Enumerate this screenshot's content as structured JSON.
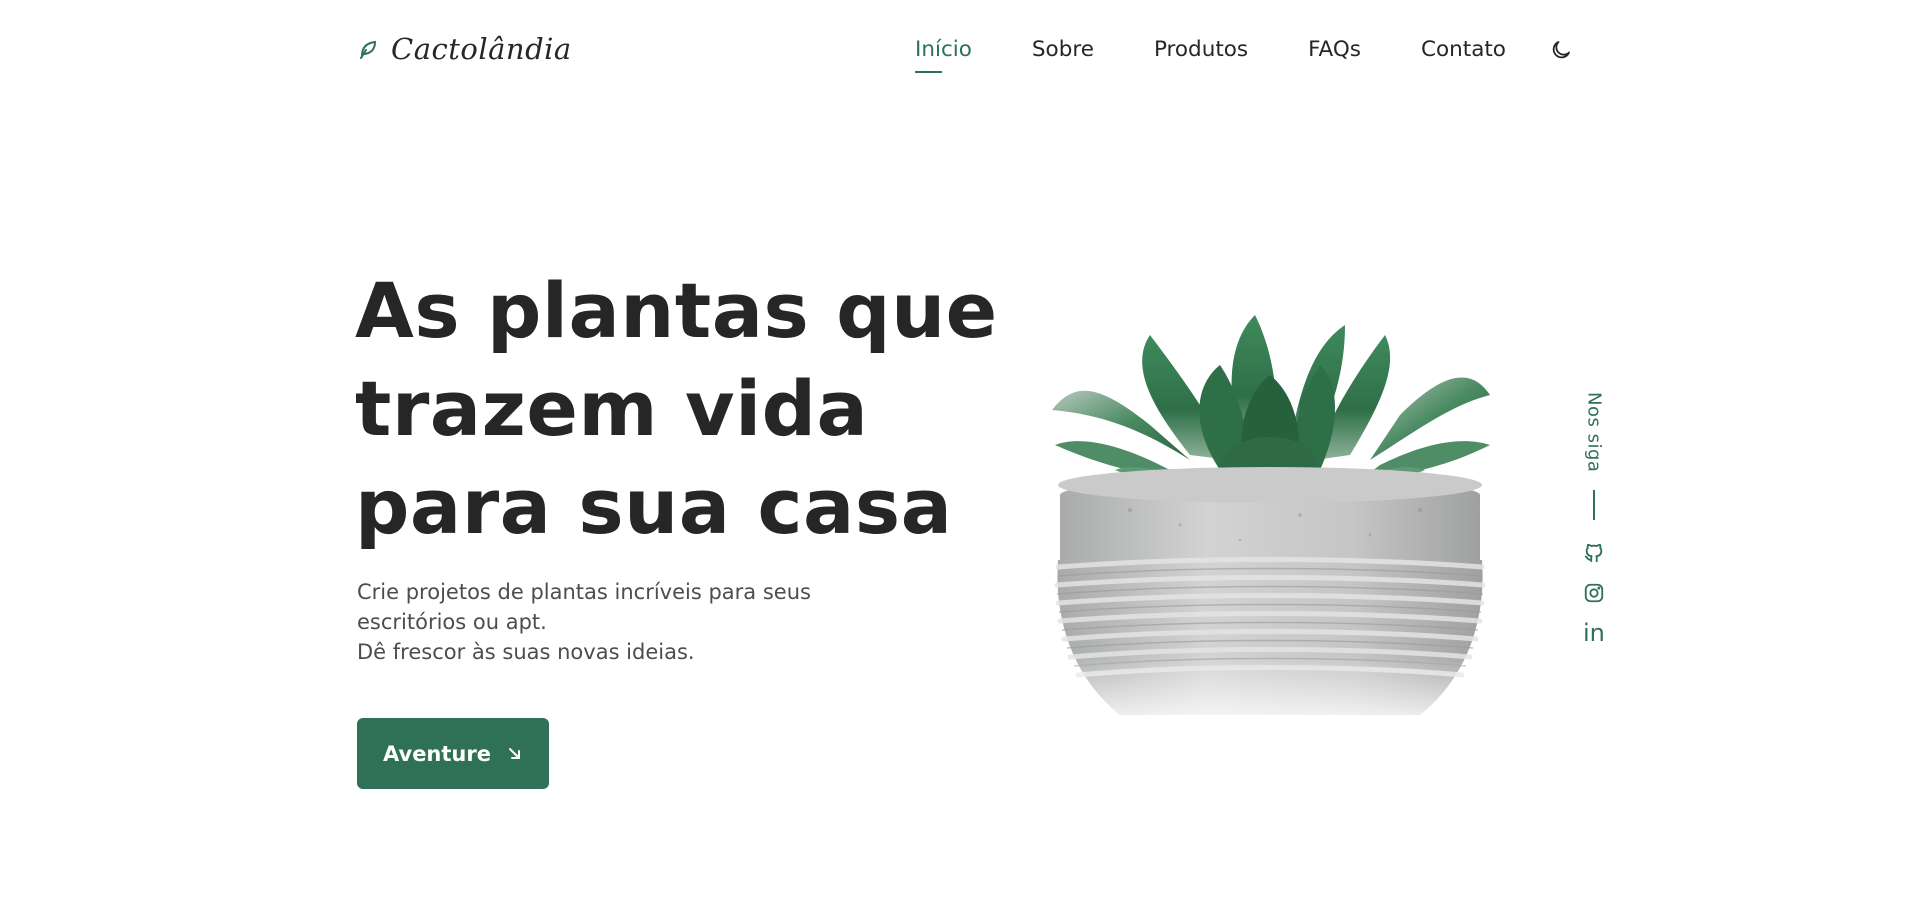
{
  "brand": {
    "name": "Cactolândia",
    "icon": "leaf-icon",
    "accent_color": "#2e7156"
  },
  "nav": {
    "items": [
      {
        "label": "Início",
        "active": true
      },
      {
        "label": "Sobre",
        "active": false
      },
      {
        "label": "Produtos",
        "active": false
      },
      {
        "label": "FAQs",
        "active": false
      },
      {
        "label": "Contato",
        "active": false
      }
    ],
    "theme_toggle_icon": "moon-icon"
  },
  "hero": {
    "title_lines": [
      "As plantas que",
      "trazem vida",
      "para sua casa"
    ],
    "description_lines": [
      "Crie projetos de plantas incríveis para seus",
      "escritórios ou apt.",
      "Dê frescor às suas novas ideias."
    ],
    "cta_label": "Aventure",
    "cta_icon": "arrow-down-right-icon",
    "image": "succulent-in-concrete-pot"
  },
  "social": {
    "label": "Nos siga",
    "links": [
      {
        "name": "github",
        "icon": "github-icon"
      },
      {
        "name": "instagram",
        "icon": "instagram-icon"
      },
      {
        "name": "linkedin",
        "icon": "linkedin-icon",
        "text": "in"
      }
    ]
  }
}
